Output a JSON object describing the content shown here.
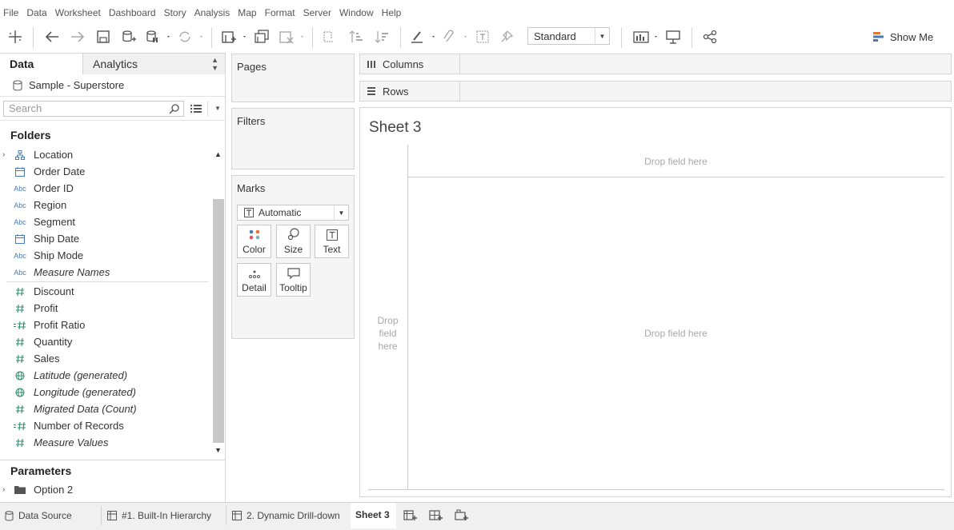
{
  "menu": [
    "File",
    "Data",
    "Worksheet",
    "Dashboard",
    "Story",
    "Analysis",
    "Map",
    "Format",
    "Server",
    "Window",
    "Help"
  ],
  "toolbar": {
    "fit_select": "Standard",
    "show_me": "Show Me"
  },
  "left": {
    "tab_data": "Data",
    "tab_analytics": "Analytics",
    "datasource": "Sample - Superstore",
    "search_placeholder": "Search",
    "folders_title": "Folders",
    "fields": [
      {
        "label": "Location",
        "icon": "hierarchy-icon"
      },
      {
        "label": "Order Date",
        "icon": "calendar-icon"
      },
      {
        "label": "Order ID",
        "icon": "abc-icon"
      },
      {
        "label": "Region",
        "icon": "abc-icon"
      },
      {
        "label": "Segment",
        "icon": "abc-icon"
      },
      {
        "label": "Ship Date",
        "icon": "calendar-icon"
      },
      {
        "label": "Ship Mode",
        "icon": "abc-icon"
      },
      {
        "label": "Measure Names",
        "icon": "abc-icon"
      },
      {
        "label": "Discount",
        "icon": "number-icon"
      },
      {
        "label": "Profit",
        "icon": "number-icon"
      },
      {
        "label": "Profit Ratio",
        "icon": "calc-number-icon"
      },
      {
        "label": "Quantity",
        "icon": "number-icon"
      },
      {
        "label": "Sales",
        "icon": "number-icon"
      },
      {
        "label": "Latitude (generated)",
        "icon": "globe-icon"
      },
      {
        "label": "Longitude (generated)",
        "icon": "globe-icon"
      },
      {
        "label": "Migrated Data (Count)",
        "icon": "number-icon"
      },
      {
        "label": "Number of Records",
        "icon": "calc-number-icon"
      },
      {
        "label": "Measure Values",
        "icon": "number-icon"
      }
    ],
    "abc": "Abc",
    "parameters_title": "Parameters",
    "parameter_item": "Option 2"
  },
  "shelves": {
    "pages": "Pages",
    "filters": "Filters",
    "marks": "Marks",
    "marks_type": "Automatic",
    "mark_buttons": [
      "Color",
      "Size",
      "Text",
      "Detail",
      "Tooltip"
    ],
    "columns": "Columns",
    "rows": "Rows"
  },
  "sheet": {
    "title": "Sheet 3",
    "drop_top": "Drop field here",
    "drop_center": "Drop field here",
    "drop_left": "Drop field here"
  },
  "bottom_tabs": [
    "Data Source",
    "#1. Built-In Hierarchy",
    "2. Dynamic Drill-down",
    "Sheet 3"
  ],
  "colors": {
    "accent_blue": "#4a7bb7",
    "measure_green": "#2f8c6b",
    "showme_orange": "#e8762c"
  }
}
